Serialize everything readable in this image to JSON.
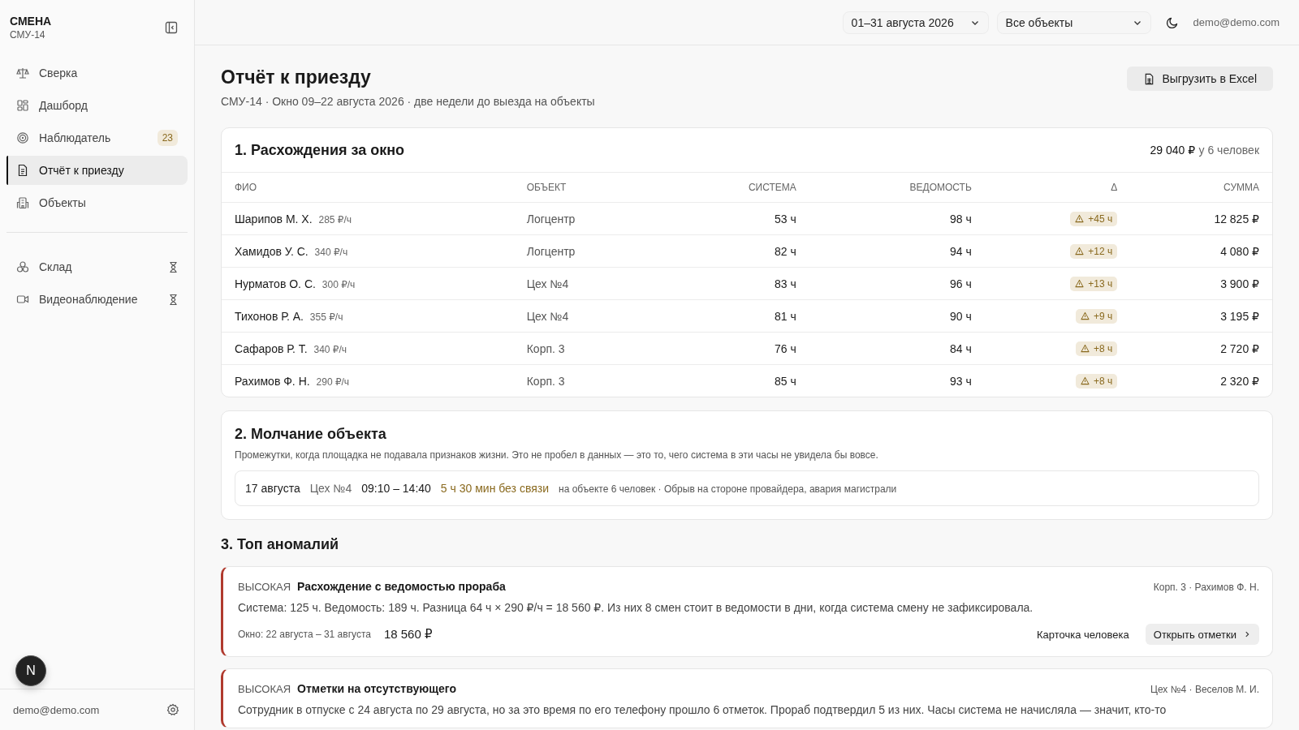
{
  "sidebar": {
    "brand": "СМЕНА",
    "org": "СМУ-14",
    "items": [
      {
        "label": "Сверка",
        "selected": false
      },
      {
        "label": "Дашборд",
        "selected": false
      },
      {
        "label": "Наблюдатель",
        "selected": false,
        "badge": "23"
      },
      {
        "label": "Отчёт к приезду",
        "selected": true
      },
      {
        "label": "Объекты",
        "selected": false
      }
    ],
    "extra_items": [
      {
        "label": "Склад",
        "pending": true
      },
      {
        "label": "Видеонаблюдение",
        "pending": true
      }
    ],
    "user_email": "demo@demo.com",
    "dev_badge": "N"
  },
  "header": {
    "period": "01–31 августа 2026",
    "objects": "Все объекты",
    "email": "demo@demo.com"
  },
  "page": {
    "title": "Отчёт к приезду",
    "subtitle": "СМУ-14 · Окно 09–22 августа 2026 · две недели до выезда на объекты",
    "export_button": "Выгрузить в Excel"
  },
  "discrepancies": {
    "title": "1. Расхождения за окно",
    "total": "29 040 ₽",
    "total_note": "у 6 человек",
    "columns": [
      "ФИО",
      "ОБЪЕКТ",
      "СИСТЕМА",
      "ВЕДОМОСТЬ",
      "Δ",
      "СУММА"
    ],
    "rows": [
      {
        "name": "Шарипов М. Х.",
        "rate": "285 ₽/ч",
        "object": "Логцентр",
        "system": "53 ч",
        "sheet": "98 ч",
        "delta": "+45 ч",
        "sum": "12 825 ₽"
      },
      {
        "name": "Хамидов У. С.",
        "rate": "340 ₽/ч",
        "object": "Логцентр",
        "system": "82 ч",
        "sheet": "94 ч",
        "delta": "+12 ч",
        "sum": "4 080 ₽"
      },
      {
        "name": "Нурматов О. С.",
        "rate": "300 ₽/ч",
        "object": "Цех №4",
        "system": "83 ч",
        "sheet": "96 ч",
        "delta": "+13 ч",
        "sum": "3 900 ₽"
      },
      {
        "name": "Тихонов Р. А.",
        "rate": "355 ₽/ч",
        "object": "Цех №4",
        "system": "81 ч",
        "sheet": "90 ч",
        "delta": "+9 ч",
        "sum": "3 195 ₽"
      },
      {
        "name": "Сафаров Р. Т.",
        "rate": "340 ₽/ч",
        "object": "Корп. 3",
        "system": "76 ч",
        "sheet": "84 ч",
        "delta": "+8 ч",
        "sum": "2 720 ₽"
      },
      {
        "name": "Рахимов Ф. Н.",
        "rate": "290 ₽/ч",
        "object": "Корп. 3",
        "system": "85 ч",
        "sheet": "93 ч",
        "delta": "+8 ч",
        "sum": "2 320 ₽"
      }
    ]
  },
  "silence": {
    "title": "2. Молчание объекта",
    "description": "Промежутки, когда площадка не подавала признаков жизни. Это не пробел в данных — это то, чего система в эти часы не увидела бы вовсе.",
    "events": [
      {
        "date": "17 августа",
        "object": "Цех №4",
        "time": "09:10 – 14:40",
        "duration": "5 ч 30 мин без связи",
        "note": "на объекте 6 человек · Обрыв на стороне провайдера, авария магистрали"
      }
    ]
  },
  "anomalies": {
    "title": "3. Топ аномалий",
    "items": [
      {
        "severity": "ВЫСОКАЯ",
        "title": "Расхождение с ведомостью прораба",
        "location": "Корп. 3 · Рахимов Ф. Н.",
        "description": "Система: 125 ч. Ведомость: 189 ч. Разница 64 ч × 290 ₽/ч = 18 560 ₽. Из них 8 смен стоит в ведомости в дни, когда система смену не зафиксировала.",
        "window": "Окно: 22 августа – 31 августа",
        "amount": "18 560 ₽",
        "link": "Карточка человека",
        "action": "Открыть отметки"
      },
      {
        "severity": "ВЫСОКАЯ",
        "title": "Отметки на отсутствующего",
        "location": "Цех №4 · Веселов М. И.",
        "description": "Сотрудник в отпуске с 24 августа по 29 августа, но за это время по его телефону прошло 6 отметок. Прораб подтвердил 5 из них. Часы система не начисляла — значит, кто-то"
      }
    ]
  }
}
